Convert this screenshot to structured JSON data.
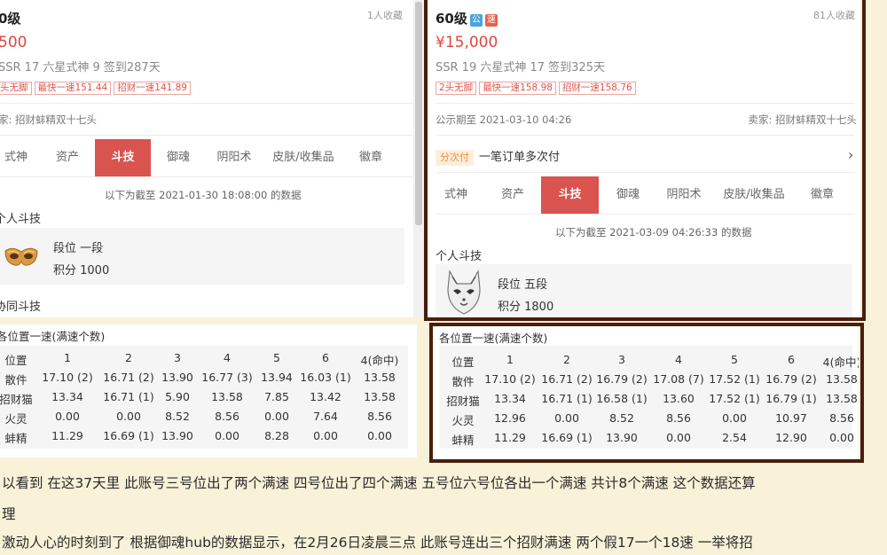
{
  "left_card": {
    "level": "0级",
    "favorites": "1人收藏",
    "price": "500",
    "stats": "SSR 17  六星式神 9  签到287天",
    "tags": [
      "头无脚",
      "最快一速151.44",
      "招财一速141.89"
    ],
    "seller": "家: 招财蚌精双十七头",
    "tabs": [
      "式神",
      "资产",
      "斗技",
      "御魂",
      "阴阳术",
      "皮肤/收集品",
      "徽章"
    ],
    "active_tab": "斗技",
    "as_of": "以下为截至 2021-01-30 18:08:00 的数据",
    "personal_pvp": "个人斗技",
    "rank_label": "段位  一段",
    "points_label": "积分  1000",
    "guild_pvp": "协同斗技"
  },
  "right_card": {
    "level": "60级",
    "badge_public": "公",
    "badge_fast": "速",
    "favorites": "81人收藏",
    "price": "¥15,000",
    "stats": "SSR 19  六星式神 17  签到325天",
    "tags": [
      "2头无脚",
      "最快一速158.98",
      "招财一速158.76"
    ],
    "public_period": "公示期至 2021-03-10 04:26",
    "seller": "卖家: 招财蚌精双十七头",
    "installment_pill": "分次付",
    "installment_text": "一笔订单多次付",
    "tabs": [
      "式神",
      "资产",
      "斗技",
      "御魂",
      "阴阳术",
      "皮肤/收集品",
      "徽章"
    ],
    "active_tab": "斗技",
    "as_of": "以下为截至 2021-03-09 04:26:33 的数据",
    "personal_pvp": "个人斗技",
    "rank_label": "段位  五段",
    "points_label": "积分  1800"
  },
  "left_table": {
    "title": "各位置一速(满速个数)",
    "headers": [
      "位置",
      "1",
      "2",
      "3",
      "4",
      "5",
      "6",
      "4(命中)"
    ],
    "rows": [
      [
        "散件",
        "17.10 (2)",
        "16.71 (2)",
        "13.90",
        "16.77 (3)",
        "13.94",
        "16.03 (1)",
        "13.58"
      ],
      [
        "招财猫",
        "13.34",
        "16.71 (1)",
        "5.90",
        "13.58",
        "7.85",
        "13.42",
        "13.58"
      ],
      [
        "火灵",
        "0.00",
        "0.00",
        "8.52",
        "8.56",
        "0.00",
        "7.64",
        "8.56"
      ],
      [
        "蚌精",
        "11.29",
        "16.69 (1)",
        "13.90",
        "0.00",
        "8.28",
        "0.00",
        "0.00"
      ]
    ]
  },
  "right_table": {
    "title": "各位置一速(满速个数)",
    "headers": [
      "位置",
      "1",
      "2",
      "3",
      "4",
      "5",
      "6",
      "4(命中)"
    ],
    "rows": [
      [
        "散件",
        "17.10 (2)",
        "16.71 (2)",
        "16.79 (2)",
        "17.08 (7)",
        "17.52 (1)",
        "16.79 (2)",
        "13.58"
      ],
      [
        "招财猫",
        "13.34",
        "16.71 (1)",
        "16.58 (1)",
        "13.60",
        "17.52 (1)",
        "16.79 (1)",
        "13.58"
      ],
      [
        "火灵",
        "12.96",
        "0.00",
        "8.52",
        "8.56",
        "0.00",
        "10.97",
        "8.56"
      ],
      [
        "蚌精",
        "11.29",
        "16.69 (1)",
        "13.90",
        "0.00",
        "2.54",
        "12.90",
        "0.00"
      ]
    ]
  },
  "article": {
    "line1": "以看到 在这37天里 此账号三号位出了两个满速 四号位出了四个满速 五号位六号位各出一个满速 共计8个满速 这个数据还算",
    "line2": "理",
    "line3": "激动人心的时刻到了 根据御魂hub的数据显示，在2月26日凌晨三点 此账号连出三个招财满速 两个假17一个18速 一举将招"
  },
  "colors": {
    "accent_red": "#d9534f",
    "price_red": "#e0463f",
    "frame_brown": "#4a1e0e",
    "page_bg": "#f9f1d8"
  }
}
